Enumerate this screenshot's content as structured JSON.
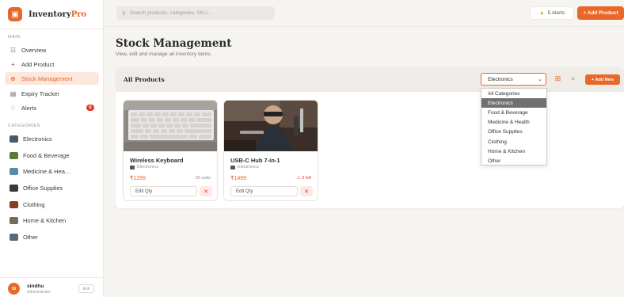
{
  "app": {
    "name_part1": "Inventory",
    "name_part2": "Pro",
    "logo_icon": "box-icon"
  },
  "sidebar": {
    "main_label": "MAIN",
    "nav": [
      {
        "label": "Overview",
        "icon": "grid-icon"
      },
      {
        "label": "Add Product",
        "icon": "plus-icon"
      },
      {
        "label": "Stock Management",
        "icon": "box-icon",
        "active": true
      },
      {
        "label": "Expiry Tracker",
        "icon": "calendar-icon"
      },
      {
        "label": "Alerts",
        "icon": "bell-icon",
        "badge": "6"
      }
    ],
    "categories_label": "CATEGORIES",
    "categories": [
      {
        "label": "Electronics",
        "color": "#4a5a6a"
      },
      {
        "label": "Food & Beverage",
        "color": "#5a7a3a"
      },
      {
        "label": "Medicine & Hea...",
        "color": "#5a8aaa"
      },
      {
        "label": "Office Supplies",
        "color": "#3a3a3a"
      },
      {
        "label": "Clothing",
        "color": "#8a3a2a"
      },
      {
        "label": "Home & Kitchen",
        "color": "#7a6a5a"
      },
      {
        "label": "Other",
        "color": "#5a6a7a"
      }
    ]
  },
  "user": {
    "initials": "SI",
    "name": "sindhu",
    "role": "Administrator",
    "exit_label": "Exit"
  },
  "topbar": {
    "search_placeholder": "Search products, categories, SKU...",
    "alerts_label": "5 Alerts",
    "add_product_label": "+ Add Product"
  },
  "page": {
    "title": "Stock Management",
    "subtitle": "View, edit and manage all inventory items."
  },
  "panel": {
    "title": "All Products",
    "select_value": "Electronics",
    "add_new_label": "+ Add New",
    "dropdown_options": [
      "All Categories",
      "Electronics",
      "Food & Beverage",
      "Medicine & Health",
      "Office Supplies",
      "Clothing",
      "Home & Kitchen",
      "Other"
    ],
    "dropdown_selected_index": 1
  },
  "products": [
    {
      "name": "Wireless Keyboard",
      "category": "Electronics",
      "price": "₹1299",
      "stock": "25 units",
      "low_stock": false,
      "edit_label": "Edit Qty",
      "delete_label": "✕"
    },
    {
      "name": "USB-C Hub 7-in-1",
      "category": "Electronics",
      "price": "₹1499",
      "stock": "⚠ 3 left",
      "low_stock": true,
      "edit_label": "Edit Qty",
      "delete_label": "✕"
    }
  ],
  "colors": {
    "accent": "#e8682a",
    "danger": "#e23b2e"
  }
}
